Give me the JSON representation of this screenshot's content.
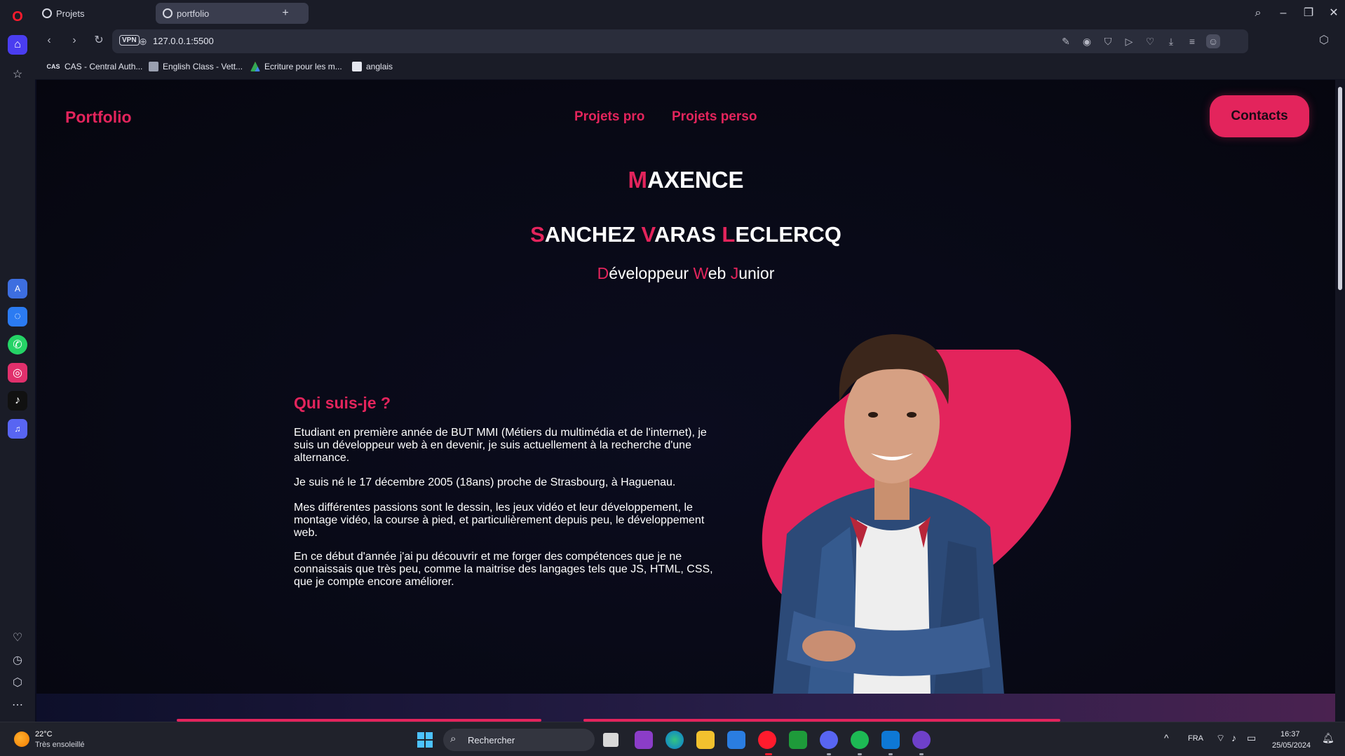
{
  "browser": {
    "tabs": [
      {
        "label": "Projets"
      },
      {
        "label": "portfolio"
      }
    ],
    "vpn_label": "VPN",
    "url": "127.0.0.1:5500",
    "bookmarks": [
      {
        "label": "CAS - Central Auth..."
      },
      {
        "label": "English Class - Vett..."
      },
      {
        "label": "Ecriture pour les m..."
      },
      {
        "label": "anglais"
      }
    ],
    "cas_badge": "CAS"
  },
  "site": {
    "logo": "Portfolio",
    "nav": {
      "pro": "Projets pro",
      "perso": "Projets perso"
    },
    "contacts": "Contacts",
    "firstname": {
      "initial": "M",
      "rest": "AXENCE"
    },
    "lastname": {
      "s_initial": "S",
      "s_rest": "ANCHEZ ",
      "v_initial": "V",
      "v_rest": "ARAS ",
      "l_initial": "L",
      "l_rest": "ECLERCQ"
    },
    "role": {
      "d_initial": "D",
      "d_rest": "éveloppeur ",
      "w_initial": "W",
      "w_rest": "eb ",
      "j_initial": "J",
      "j_rest": "unior"
    },
    "about": {
      "title": "Qui suis-je ?",
      "paragraphs": [
        "Etudiant en première année de BUT MMI (Métiers du multimédia et de l'internet), je suis un développeur web à en devenir, je suis actuellement à la recherche d'une alternance.",
        "Je suis né le 17 décembre 2005 (18ans) proche de Strasbourg, à Haguenau.",
        "Mes différentes passions sont le dessin, les jeux vidéo et leur développement, le montage vidéo, la course à pied, et particulièrement depuis peu, le développement web.",
        "En ce début d'année j'ai pu découvrir et me forger des compétences que je ne connaissais que très peu, comme la maitrise des langages tels que JS, HTML, CSS, que je compte encore améliorer."
      ]
    },
    "accent_color": "#e3245c"
  },
  "taskbar": {
    "temperature": "22°C",
    "weather": "Très ensoleillé",
    "search_placeholder": "Rechercher",
    "language": "FRA",
    "time": "16:37",
    "date": "25/05/2024"
  }
}
